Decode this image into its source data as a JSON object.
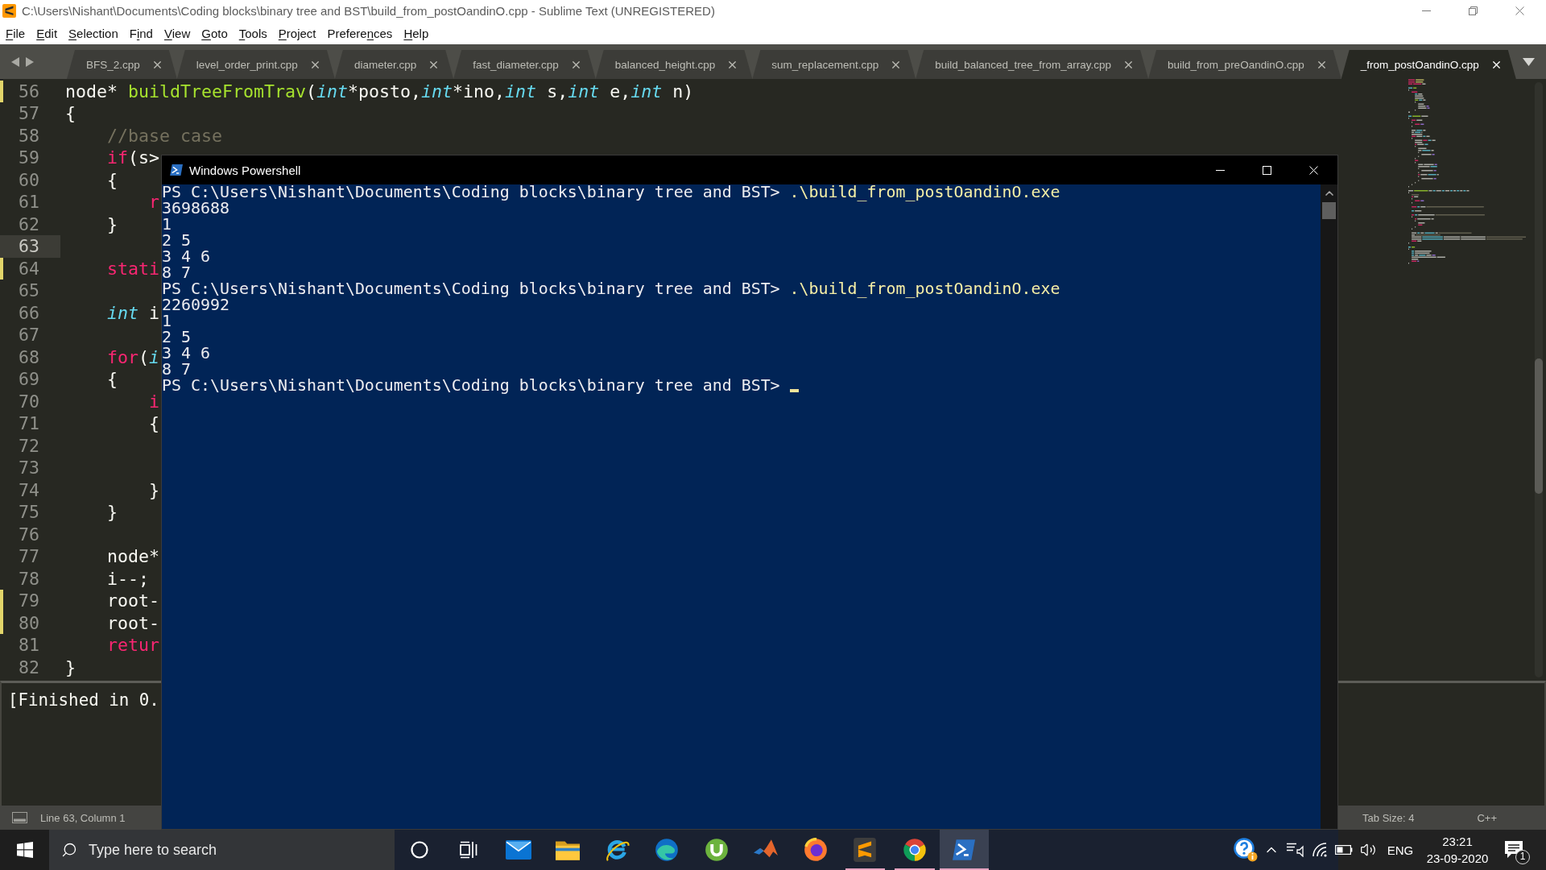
{
  "window": {
    "title": "C:\\Users\\Nishant\\Documents\\Coding blocks\\binary tree and BST\\build_from_postOandinO.cpp - Sublime Text (UNREGISTERED)"
  },
  "menu": [
    {
      "key": "F",
      "after": "ile"
    },
    {
      "key": "E",
      "after": "dit"
    },
    {
      "key": "S",
      "after": "election"
    },
    {
      "before": "F",
      "key": "i",
      "after": "nd"
    },
    {
      "key": "V",
      "after": "iew"
    },
    {
      "key": "G",
      "after": "oto"
    },
    {
      "key": "T",
      "after": "ools"
    },
    {
      "key": "P",
      "after": "roject"
    },
    {
      "before": "Prefere",
      "key": "n",
      "after": "ces"
    },
    {
      "key": "H",
      "after": "elp"
    }
  ],
  "tabs": [
    {
      "label": "BFS_2.cpp",
      "selected": false
    },
    {
      "label": "level_order_print.cpp",
      "selected": false
    },
    {
      "label": "diameter.cpp",
      "selected": false
    },
    {
      "label": "fast_diameter.cpp",
      "selected": false
    },
    {
      "label": "balanced_height.cpp",
      "selected": false
    },
    {
      "label": "sum_replacement.cpp",
      "selected": false
    },
    {
      "label": "build_balanced_tree_from_array.cpp",
      "selected": false
    },
    {
      "label": "build_from_preOandinO.cpp",
      "selected": false
    },
    {
      "label": "_from_postOandinO.cpp",
      "selected": true
    }
  ],
  "editor": {
    "lines": [
      {
        "number": "56",
        "modified": true,
        "current": false,
        "tokens": [
          {
            "kind": "plain",
            "text": "node* "
          },
          {
            "kind": "function",
            "text": "buildTreeFromTrav"
          },
          {
            "kind": "plain",
            "text": "("
          },
          {
            "kind": "type",
            "text": "int"
          },
          {
            "kind": "plain",
            "text": "*posto,"
          },
          {
            "kind": "type",
            "text": "int"
          },
          {
            "kind": "plain",
            "text": "*ino,"
          },
          {
            "kind": "type",
            "text": "int"
          },
          {
            "kind": "plain",
            "text": " s,"
          },
          {
            "kind": "type",
            "text": "int"
          },
          {
            "kind": "plain",
            "text": " e,"
          },
          {
            "kind": "type",
            "text": "int"
          },
          {
            "kind": "plain",
            "text": " n)"
          }
        ]
      },
      {
        "number": "57",
        "modified": false,
        "current": false,
        "tokens": [
          {
            "kind": "plain",
            "text": "{"
          }
        ]
      },
      {
        "number": "58",
        "modified": false,
        "current": false,
        "tokens": [
          {
            "kind": "comment",
            "text": "    //base case"
          }
        ]
      },
      {
        "number": "59",
        "modified": false,
        "current": false,
        "tokens": [
          {
            "kind": "keyword",
            "text": "    if"
          },
          {
            "kind": "plain",
            "text": "(s>"
          }
        ]
      },
      {
        "number": "60",
        "modified": false,
        "current": false,
        "tokens": [
          {
            "kind": "plain",
            "text": "    {"
          }
        ]
      },
      {
        "number": "61",
        "modified": false,
        "current": false,
        "tokens": [
          {
            "kind": "keyword",
            "text": "        r"
          }
        ]
      },
      {
        "number": "62",
        "modified": false,
        "current": false,
        "tokens": [
          {
            "kind": "plain",
            "text": "    }"
          }
        ]
      },
      {
        "number": "63",
        "modified": false,
        "current": true
      },
      {
        "number": "64",
        "modified": true,
        "current": false,
        "tokens": [
          {
            "kind": "keyword",
            "text": "    stati"
          }
        ]
      },
      {
        "number": "65",
        "modified": false,
        "current": false
      },
      {
        "number": "66",
        "modified": false,
        "current": false,
        "tokens": [
          {
            "kind": "type",
            "text": "    int"
          },
          {
            "kind": "plain",
            "text": " i"
          }
        ]
      },
      {
        "number": "67",
        "modified": false,
        "current": false
      },
      {
        "number": "68",
        "modified": false,
        "current": false,
        "tokens": [
          {
            "kind": "keyword",
            "text": "    for"
          },
          {
            "kind": "plain",
            "text": "("
          },
          {
            "kind": "type",
            "text": "i"
          }
        ]
      },
      {
        "number": "69",
        "modified": false,
        "current": false,
        "tokens": [
          {
            "kind": "plain",
            "text": "    {"
          }
        ]
      },
      {
        "number": "70",
        "modified": false,
        "current": false,
        "tokens": [
          {
            "kind": "keyword",
            "text": "        i"
          }
        ]
      },
      {
        "number": "71",
        "modified": false,
        "current": false,
        "tokens": [
          {
            "kind": "plain",
            "text": "        {"
          }
        ]
      },
      {
        "number": "72",
        "modified": false,
        "current": false
      },
      {
        "number": "73",
        "modified": false,
        "current": false
      },
      {
        "number": "74",
        "modified": false,
        "current": false,
        "tokens": [
          {
            "kind": "plain",
            "text": "        }"
          }
        ]
      },
      {
        "number": "75",
        "modified": false,
        "current": false,
        "tokens": [
          {
            "kind": "plain",
            "text": "    }"
          }
        ]
      },
      {
        "number": "76",
        "modified": false,
        "current": false
      },
      {
        "number": "77",
        "modified": false,
        "current": false,
        "tokens": [
          {
            "kind": "plain",
            "text": "    node*"
          }
        ]
      },
      {
        "number": "78",
        "modified": false,
        "current": false,
        "tokens": [
          {
            "kind": "plain",
            "text": "    i--;"
          }
        ]
      },
      {
        "number": "79",
        "modified": true,
        "current": false,
        "tokens": [
          {
            "kind": "plain",
            "text": "    root-"
          }
        ]
      },
      {
        "number": "80",
        "modified": true,
        "current": false,
        "tokens": [
          {
            "kind": "plain",
            "text": "    root-"
          }
        ]
      },
      {
        "number": "81",
        "modified": false,
        "current": false,
        "tokens": [
          {
            "kind": "keyword",
            "text": "    retur"
          }
        ]
      },
      {
        "number": "82",
        "modified": false,
        "current": false,
        "tokens": [
          {
            "kind": "plain",
            "text": "}"
          }
        ]
      }
    ]
  },
  "output_panel": {
    "text": "[Finished in 0."
  },
  "status_bar": {
    "position": "Line 63, Column 1",
    "tab_size": "Tab Size: 4",
    "syntax": "C++"
  },
  "console": {
    "title": "Windows Powershell",
    "lines": [
      {
        "kind": "command",
        "prompt": "PS C:\\Users\\Nishant\\Documents\\Coding blocks\\binary tree and BST>",
        "command": ".\\build_from_postOandinO.exe"
      },
      {
        "kind": "output",
        "text": "3698688"
      },
      {
        "kind": "output",
        "text": "1"
      },
      {
        "kind": "output",
        "text": "2 5"
      },
      {
        "kind": "output",
        "text": "3 4 6"
      },
      {
        "kind": "output",
        "text": "8 7"
      },
      {
        "kind": "command",
        "prompt": "PS C:\\Users\\Nishant\\Documents\\Coding blocks\\binary tree and BST>",
        "command": ".\\build_from_postOandinO.exe"
      },
      {
        "kind": "output",
        "text": "2260992"
      },
      {
        "kind": "output",
        "text": "1"
      },
      {
        "kind": "output",
        "text": "2 5"
      },
      {
        "kind": "output",
        "text": "3 4 6"
      },
      {
        "kind": "output",
        "text": "8 7"
      },
      {
        "kind": "prompt",
        "prompt": "PS C:\\Users\\Nishant\\Documents\\Coding blocks\\binary tree and BST>"
      }
    ]
  },
  "taskbar": {
    "search": {
      "placeholder": "Type here to search"
    },
    "apps": [
      {
        "kind": "assistant",
        "running": false,
        "selected": false
      },
      {
        "kind": "task_view",
        "running": false,
        "selected": false
      },
      {
        "kind": "mail",
        "running": false,
        "selected": false
      },
      {
        "kind": "files",
        "running": false,
        "selected": false
      },
      {
        "kind": "ie",
        "running": false,
        "selected": false
      },
      {
        "kind": "edge",
        "running": false,
        "selected": false
      },
      {
        "kind": "torrent",
        "running": false,
        "selected": false
      },
      {
        "kind": "matlab",
        "running": false,
        "selected": false
      },
      {
        "kind": "firefox",
        "running": false,
        "selected": false
      },
      {
        "kind": "sublime",
        "running": true,
        "selected": false
      },
      {
        "kind": "chrome",
        "running": true,
        "selected": false
      },
      {
        "kind": "powershell",
        "running": true,
        "selected": true
      }
    ],
    "tray": {
      "language": "ENG",
      "time": "23:21",
      "date": "23-09-2020",
      "notification_count": "1"
    }
  }
}
